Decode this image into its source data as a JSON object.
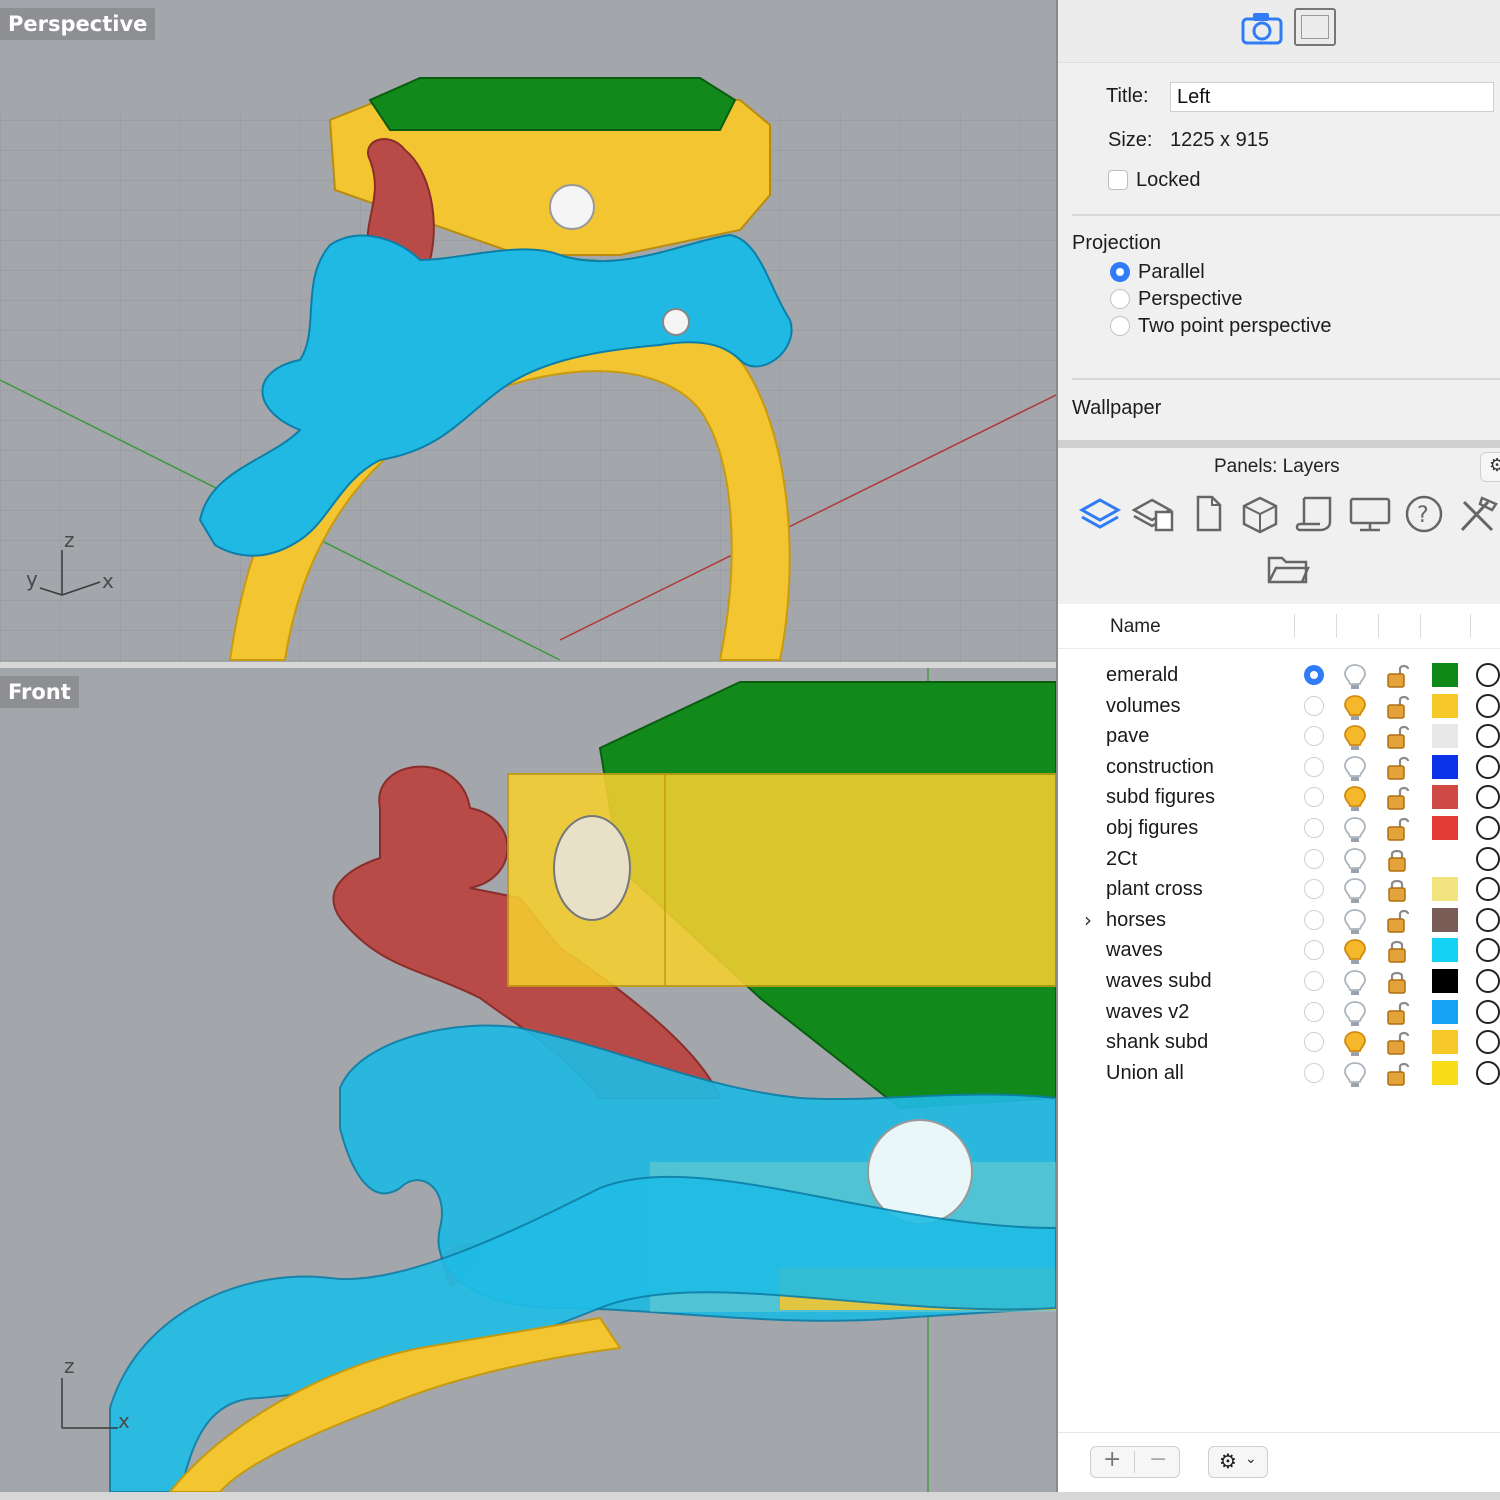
{
  "viewports": {
    "perspective": {
      "label": "Perspective",
      "axes": {
        "z": "z",
        "y": "y",
        "x": "x"
      }
    },
    "front": {
      "label": "Front",
      "axes": {
        "z": "z",
        "x": "x"
      }
    }
  },
  "properties": {
    "title_label": "Title:",
    "title_value": "Left",
    "size_label": "Size:",
    "size_value": "1225 x 915",
    "locked_label": "Locked",
    "projection_label": "Projection",
    "projection_options": [
      "Parallel",
      "Perspective",
      "Two point perspective"
    ],
    "projection_selected": "Parallel",
    "wallpaper_label": "Wallpaper"
  },
  "layers_panel": {
    "title": "Panels: Layers",
    "column_name": "Name",
    "tabs": [
      "layers-icon",
      "layer-states-icon",
      "document-icon",
      "cube-icon",
      "scroll-icon",
      "display-icon",
      "help-icon",
      "tools-icon",
      "folder-icon"
    ],
    "layers": [
      {
        "name": "emerald",
        "current": true,
        "bulb_on": false,
        "locked": false,
        "color": "#0f8a19"
      },
      {
        "name": "volumes",
        "current": false,
        "bulb_on": true,
        "locked": false,
        "color": "#f7c928"
      },
      {
        "name": "pave",
        "current": false,
        "bulb_on": true,
        "locked": false,
        "color": "#e8e8e8"
      },
      {
        "name": "construction",
        "current": false,
        "bulb_on": false,
        "locked": false,
        "color": "#0a32e8"
      },
      {
        "name": "subd figures",
        "current": false,
        "bulb_on": true,
        "locked": false,
        "color": "#cf4a45"
      },
      {
        "name": "obj figures",
        "current": false,
        "bulb_on": false,
        "locked": false,
        "color": "#e23a35"
      },
      {
        "name": "2Ct",
        "current": false,
        "bulb_on": false,
        "locked": true,
        "color": "#ffffff"
      },
      {
        "name": "plant cross",
        "current": false,
        "bulb_on": false,
        "locked": true,
        "color": "#f1e37d"
      },
      {
        "name": "horses",
        "current": false,
        "bulb_on": false,
        "locked": false,
        "color": "#7b5d57",
        "expandable": true
      },
      {
        "name": "waves",
        "current": false,
        "bulb_on": true,
        "locked": true,
        "color": "#16d2f5"
      },
      {
        "name": "waves subd",
        "current": false,
        "bulb_on": false,
        "locked": true,
        "color": "#000000"
      },
      {
        "name": "waves v2",
        "current": false,
        "bulb_on": false,
        "locked": false,
        "color": "#17a3f5"
      },
      {
        "name": "shank subd",
        "current": false,
        "bulb_on": true,
        "locked": false,
        "color": "#f7c928"
      },
      {
        "name": "Union all",
        "current": false,
        "bulb_on": false,
        "locked": false,
        "color": "#f9dc18"
      }
    ],
    "footer": {
      "add": "+",
      "remove": "−",
      "gear": "⚙"
    }
  },
  "colors": {
    "accent": "#2f7cf6",
    "viewport_bg": "#a3a6ab",
    "gem_green": "#118a1b",
    "gold": "#f2c531",
    "wave_blue": "#20b9e3",
    "figure_red": "#b84a47"
  }
}
